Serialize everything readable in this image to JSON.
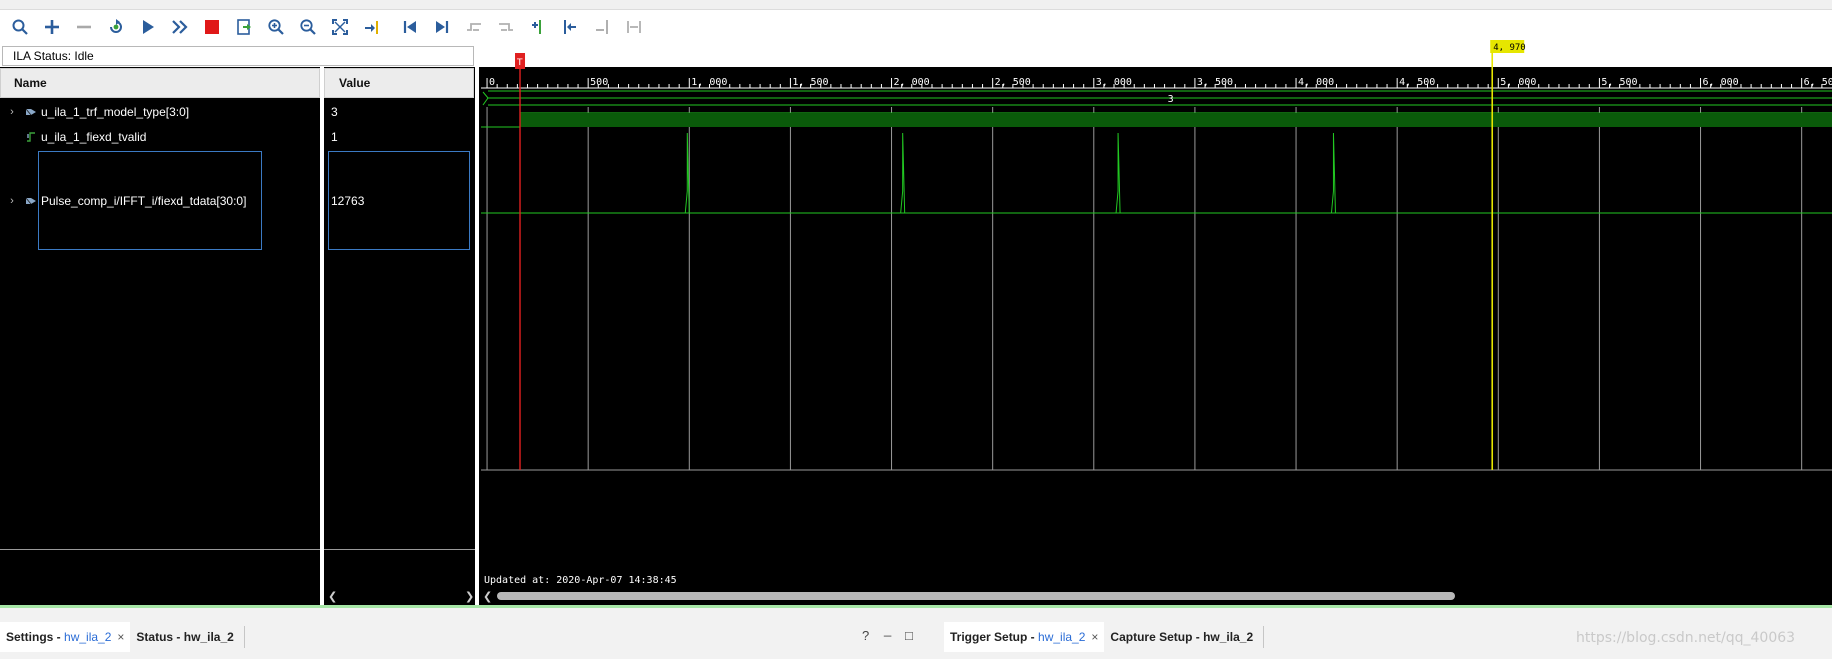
{
  "toolbar": {
    "buttons": [
      {
        "name": "search-icon"
      },
      {
        "name": "add-icon"
      },
      {
        "name": "remove-icon"
      },
      {
        "name": "run-trigger-immediate-icon"
      },
      {
        "name": "run-trigger-icon"
      },
      {
        "name": "run-trigger-continuous-icon"
      },
      {
        "name": "stop-trigger-icon"
      },
      {
        "name": "export-icon"
      },
      {
        "name": "zoom-in-icon"
      },
      {
        "name": "zoom-out-icon"
      },
      {
        "name": "zoom-fit-icon"
      },
      {
        "name": "goto-cursor-icon"
      },
      {
        "name": "goto-time-zero-icon"
      },
      {
        "name": "goto-last-time-icon"
      },
      {
        "name": "previous-transition-icon"
      },
      {
        "name": "next-transition-icon"
      },
      {
        "name": "add-marker-icon"
      },
      {
        "name": "previous-marker-icon"
      },
      {
        "name": "next-marker-icon"
      },
      {
        "name": "swap-cursors-icon"
      }
    ]
  },
  "ila_status": "ILA Status: Idle",
  "columns": {
    "name": "Name",
    "value": "Value"
  },
  "signals": [
    {
      "name": "u_ila_1_trf_model_type[3:0]",
      "value": "3",
      "type": "bus"
    },
    {
      "name": "u_ila_1_fiexd_tvalid",
      "value": "1",
      "type": "bit"
    },
    {
      "name": "Pulse_comp_i/IFFT_i/fiexd_tdata[30:0]",
      "value": "12763",
      "type": "analog-bus"
    }
  ],
  "waveform": {
    "ruler_labels": [
      "0",
      "500",
      "1, 000",
      "1, 500",
      "2, 000",
      "2, 500",
      "3, 000",
      "3, 500",
      "4, 000",
      "4, 500",
      "5, 000",
      "5, 500",
      "6, 000",
      "6, 500"
    ],
    "ruler_values": [
      0,
      500,
      1000,
      1500,
      2000,
      2500,
      3000,
      3500,
      4000,
      4500,
      5000,
      5500,
      6000,
      6500
    ],
    "visible_range": [
      -20,
      6650
    ],
    "trigger_marker": {
      "label": "T",
      "position": 163
    },
    "cursor": {
      "label": "4, 970",
      "position": 4970
    },
    "bus_value_label": "3",
    "pulses": [
      990,
      2055,
      3120,
      4185
    ],
    "colors": {
      "wave": "#22c922",
      "valid_fill": "#0a5a0a",
      "trigger": "#e02020",
      "cursor": "#e6e600",
      "grid": "#9a9a9a"
    }
  },
  "updated_at": "Updated at: 2020-Apr-07 14:38:45",
  "bottom_tabs_left": [
    {
      "label": "Settings",
      "sub": "hw_ila_2",
      "active": true,
      "closable": true
    },
    {
      "label": "Status",
      "sub": "hw_ila_2",
      "active": false,
      "closable": false
    }
  ],
  "bottom_tabs_right": [
    {
      "label": "Trigger Setup",
      "sub": "hw_ila_2",
      "active": true,
      "closable": true
    },
    {
      "label": "Capture Setup",
      "sub": "hw_ila_2",
      "active": false,
      "closable": false
    }
  ],
  "panel_controls": {
    "help": "?",
    "minimize": "_",
    "maximize": "□",
    "close": "×"
  },
  "watermark": "https://blog.csdn.net/qq_40063"
}
